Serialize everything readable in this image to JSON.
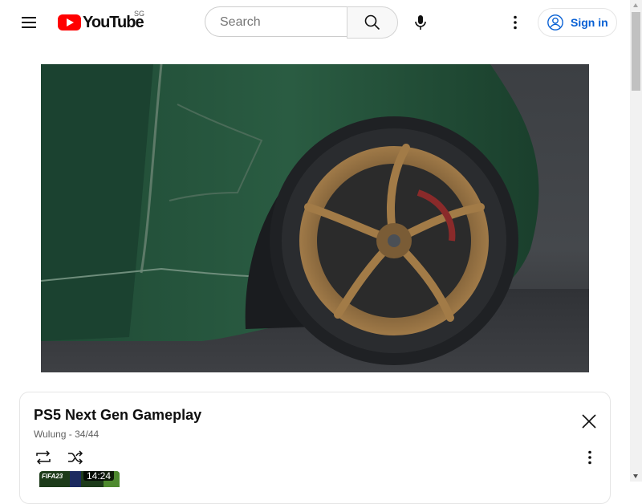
{
  "header": {
    "logo_text": "YouTube",
    "country_code": "SG",
    "search_placeholder": "Search",
    "signin_label": "Sign in"
  },
  "player": {
    "video_description": "Green car wheel with bronze rim"
  },
  "playlist": {
    "title": "PS5 Next Gen Gameplay",
    "owner": "Wulung",
    "position": "34/44",
    "subtitle": "Wulung - 34/44",
    "current_item": {
      "thumb_text": "FIFA23",
      "duration": "14:24"
    }
  },
  "icons": {
    "menu": "hamburger-icon",
    "search": "search-icon",
    "mic": "mic-icon",
    "more": "more-vert-icon",
    "account": "account-circle-icon",
    "close": "close-icon",
    "loop": "loop-icon",
    "shuffle": "shuffle-icon"
  },
  "colors": {
    "brand_red": "#ff0000",
    "link_blue": "#065fd4"
  }
}
